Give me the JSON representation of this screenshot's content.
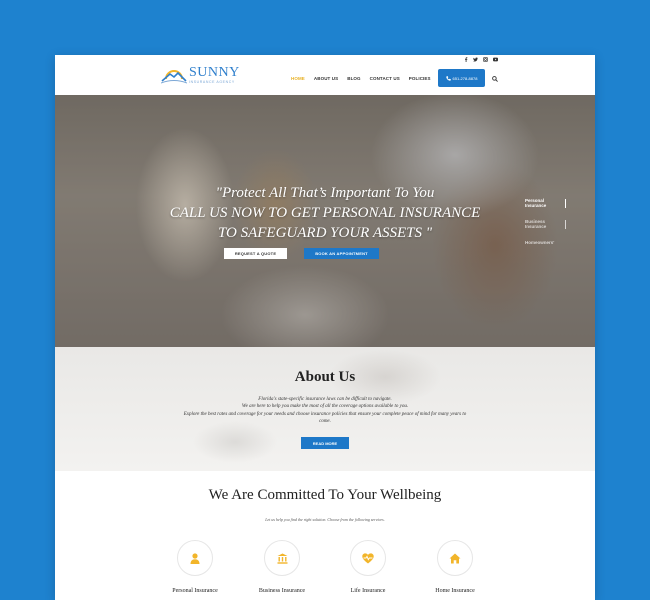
{
  "brand": {
    "name": "SUNNY",
    "tagline": "INSURANCE AGENCY"
  },
  "social": {
    "icons": [
      "facebook-icon",
      "twitter-icon",
      "instagram-icon",
      "youtube-icon"
    ]
  },
  "nav": {
    "items": [
      {
        "label": "HOME",
        "active": true
      },
      {
        "label": "ABOUT US",
        "active": false
      },
      {
        "label": "BLOG",
        "active": false
      },
      {
        "label": "CONTACT US",
        "active": false
      },
      {
        "label": "POLICIES",
        "active": false
      }
    ],
    "phone": "651-278-8878"
  },
  "hero": {
    "line1": "\"Protect All That’s Important To You",
    "line2": "CALL US NOW TO GET PERSONAL INSURANCE",
    "line3": "TO SAFEGUARD YOUR ASSETS \"",
    "btn_quote": "REQUEST A QUOTE",
    "btn_appointment": "BOOK AN APPOINTMENT",
    "side_nav": [
      {
        "label_line1": "Personal",
        "label_line2": "Insurance"
      },
      {
        "label_line1": "Business",
        "label_line2": "Insurance"
      },
      {
        "label_line1": "Homeowners'",
        "label_line2": ""
      }
    ]
  },
  "about": {
    "title": "About Us",
    "line1": "Florida's state-specific insurance laws can be difficult to navigate.",
    "line2": "We are here to help you make the most of all the coverage options available to you.",
    "line3": "Explore the best rates and coverage for your needs and choose insurance policies that ensure your complete peace of mind for many years to",
    "line4": "come.",
    "button": "READ MORE"
  },
  "wellbeing": {
    "title": "We Are Committed To Your Wellbeing",
    "subtitle": "Let us help you find the right solution. Choose from the following services.",
    "services": [
      {
        "label": "Personal Insurance",
        "icon": "person-icon"
      },
      {
        "label": "Business Insurance",
        "icon": "bank-icon"
      },
      {
        "label": "Life Insurance",
        "icon": "heartbeat-icon"
      },
      {
        "label": "Home Insurance",
        "icon": "home-icon"
      }
    ]
  },
  "colors": {
    "background": "#1e82cf",
    "accent_blue": "#1e78c8",
    "accent_yellow": "#e8b227"
  }
}
